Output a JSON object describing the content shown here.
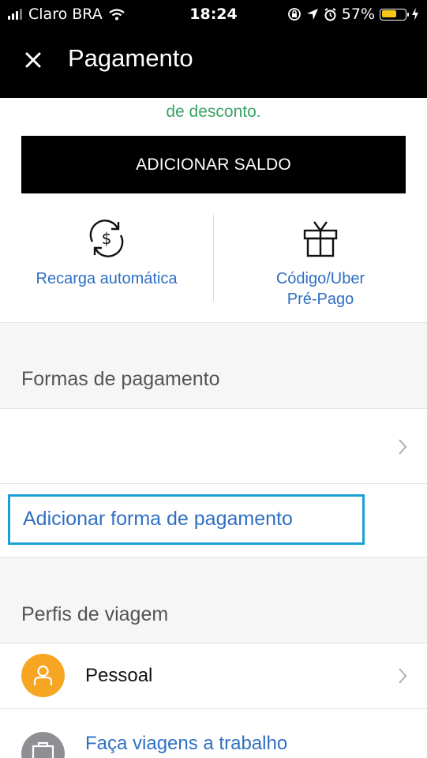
{
  "status_bar": {
    "carrier": "Claro BRA",
    "time": "18:24",
    "battery": "57%",
    "battery_level": 0.57,
    "battery_color": "#f5c518"
  },
  "nav": {
    "title": "Pagamento",
    "close_icon": "close-icon"
  },
  "wallet": {
    "discount_text": "de desconto.",
    "add_balance_label": "ADICIONAR SALDO",
    "auto_recharge": {
      "label": "Recarga automática",
      "icon": "dollar-refresh-icon"
    },
    "gift_code": {
      "label_line1": "Código/Uber",
      "label_line2": "Pré-Pago",
      "icon": "gift-icon"
    }
  },
  "payment_methods": {
    "header": "Formas de pagamento",
    "add_label": "Adicionar forma de pagamento"
  },
  "travel_profiles": {
    "header": "Perfis de viagem",
    "personal_label": "Pessoal",
    "work_label": "Faça viagens a trabalho"
  },
  "colors": {
    "accent_blue": "#2f6fc2",
    "discount_green": "#3aa364",
    "highlight_border": "#1aa0d6",
    "personal_avatar": "#f6a623",
    "work_avatar": "#8e8e93"
  }
}
